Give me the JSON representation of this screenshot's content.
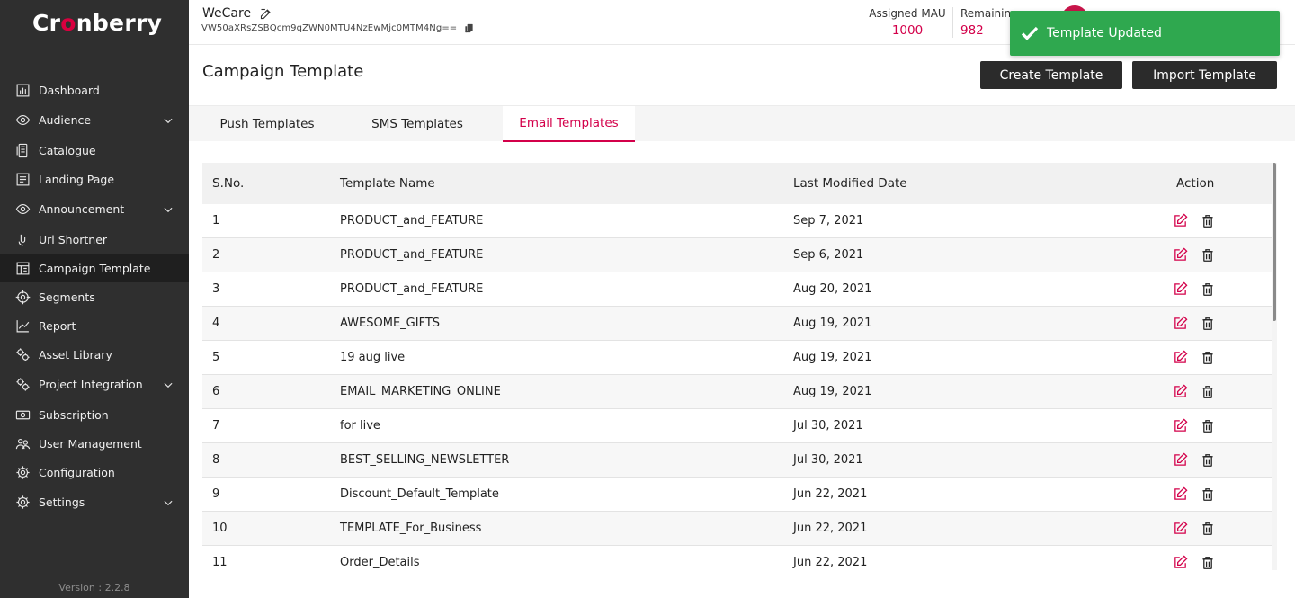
{
  "brand": {
    "logo_text": "Cr nberry",
    "accent": "#d3004a"
  },
  "sidebar": {
    "items": [
      {
        "label": "Dashboard",
        "icon": "chart-icon",
        "expandable": false,
        "active": false
      },
      {
        "label": "Audience",
        "icon": "eye-icon",
        "expandable": true,
        "active": false
      },
      {
        "label": "Catalogue",
        "icon": "catalogue-icon",
        "expandable": false,
        "active": false
      },
      {
        "label": "Landing Page",
        "icon": "page-icon",
        "expandable": false,
        "active": false
      },
      {
        "label": "Announcement",
        "icon": "eye-icon",
        "expandable": true,
        "active": false
      },
      {
        "label": "Url Shortner",
        "icon": "link-icon",
        "expandable": false,
        "active": false
      },
      {
        "label": "Campaign Template",
        "icon": "template-icon",
        "expandable": false,
        "active": true
      },
      {
        "label": "Segments",
        "icon": "target-icon",
        "expandable": false,
        "active": false
      },
      {
        "label": "Report",
        "icon": "trend-icon",
        "expandable": false,
        "active": false
      },
      {
        "label": "Asset Library",
        "icon": "gears-icon",
        "expandable": false,
        "active": false
      },
      {
        "label": "Project Integration",
        "icon": "gears-icon",
        "expandable": true,
        "active": false
      },
      {
        "label": "Subscription",
        "icon": "money-icon",
        "expandable": false,
        "active": false
      },
      {
        "label": "User Management",
        "icon": "users-icon",
        "expandable": false,
        "active": false
      },
      {
        "label": "Configuration",
        "icon": "gear-icon",
        "expandable": false,
        "active": false
      },
      {
        "label": "Settings",
        "icon": "gear-icon",
        "expandable": true,
        "active": false
      }
    ],
    "version": "Version : 2.2.8"
  },
  "header": {
    "app_name": "WeCare",
    "app_key": "VW50aXRsZSBQcm9qZWN0MTU4NzEwMjc0MTM4Ng==",
    "assigned_mau_label": "Assigned MAU",
    "assigned_mau_value": "1000",
    "remaining_mau_label": "Remainin",
    "remaining_mau_value": "982"
  },
  "toast": {
    "message": "Template Updated",
    "color": "#2fa84f"
  },
  "page": {
    "title": "Campaign Template",
    "create_button": "Create Template",
    "import_button": "Import Template"
  },
  "tabs": [
    {
      "label": "Push Templates",
      "active": false
    },
    {
      "label": "SMS Templates",
      "active": false
    },
    {
      "label": "Email Templates",
      "active": true
    }
  ],
  "table": {
    "columns": [
      "S.No.",
      "Template Name",
      "Last Modified Date",
      "Action"
    ],
    "rows": [
      {
        "sno": "1",
        "name": "PRODUCT_and_FEATURE",
        "date": "Sep 7, 2021"
      },
      {
        "sno": "2",
        "name": "PRODUCT_and_FEATURE",
        "date": "Sep 6, 2021"
      },
      {
        "sno": "3",
        "name": "PRODUCT_and_FEATURE",
        "date": "Aug 20, 2021"
      },
      {
        "sno": "4",
        "name": "AWESOME_GIFTS",
        "date": "Aug 19, 2021"
      },
      {
        "sno": "5",
        "name": "19 aug live",
        "date": "Aug 19, 2021"
      },
      {
        "sno": "6",
        "name": "EMAIL_MARKETING_ONLINE",
        "date": "Aug 19, 2021"
      },
      {
        "sno": "7",
        "name": "for live",
        "date": "Jul 30, 2021"
      },
      {
        "sno": "8",
        "name": "BEST_SELLING_NEWSLETTER",
        "date": "Jul 30, 2021"
      },
      {
        "sno": "9",
        "name": "Discount_Default_Template",
        "date": "Jun 22, 2021"
      },
      {
        "sno": "10",
        "name": "TEMPLATE_For_Business",
        "date": "Jun 22, 2021"
      },
      {
        "sno": "11",
        "name": "Order_Details",
        "date": "Jun 22, 2021"
      }
    ]
  }
}
